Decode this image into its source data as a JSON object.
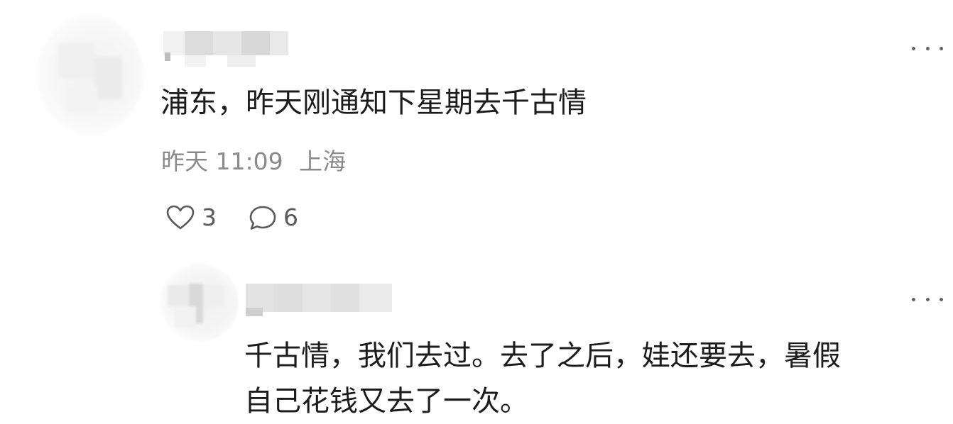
{
  "comments": [
    {
      "text": "浦东，昨天刚通知下星期去千古情",
      "time": "昨天 11:09",
      "location": "上海",
      "likes": "3",
      "replies": "6",
      "more_icon": "more-horizontal-icon"
    }
  ],
  "reply": {
    "text_line1": "千古情，我们去过。去了之后，娃还要去，暑假",
    "text_line2": "自己花钱又去了一次。",
    "more_icon": "more-horizontal-icon"
  },
  "icons": {
    "like": "heart-outline-icon",
    "comment": "speech-bubble-icon"
  },
  "colors": {
    "text_primary": "#1c1c1c",
    "text_meta": "#8a8a8a",
    "icon": "#5a5a5a",
    "background": "#ffffff"
  }
}
